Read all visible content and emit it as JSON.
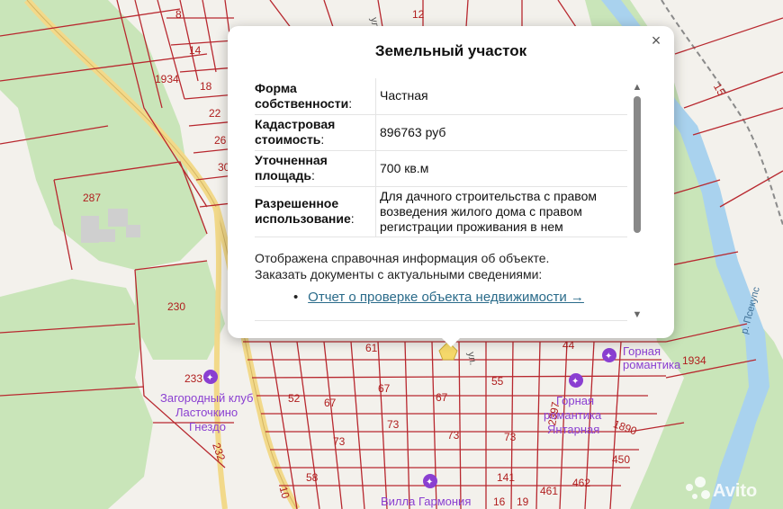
{
  "popup": {
    "title": "Земельный участок",
    "close_icon": "×",
    "rows": [
      {
        "label_line1": "Форма",
        "label_line2": "собственности",
        "value": "Частная"
      },
      {
        "label_line1": "Кадастровая",
        "label_line2": "стоимость",
        "value": "896763 руб"
      },
      {
        "label_line1": "Уточненная",
        "label_line2": "площадь",
        "value": "700 кв.м"
      },
      {
        "label_line1": "Разрешенное",
        "label_line2": "использование",
        "value": "Для дачного строительства с правом возведения жилого дома с правом регистрации проживания в нем"
      }
    ],
    "colon": ":",
    "note_line1": "Отображена справочная информация об объекте.",
    "note_line2": "Заказать документы с актуальными сведениями:",
    "report_bullet": "•",
    "report_link": "Отчет о проверке объекта недвижимости →",
    "scroll_up_icon": "▲",
    "scroll_down_icon": "▼"
  },
  "map": {
    "colors": {
      "background": "#f3f1ec",
      "forest": "#c9e5b9",
      "parcel_line": "#b8282f",
      "road": "#f2d98a",
      "river": "#a9d2ee",
      "poi": "#8a3fd1"
    },
    "parcel_labels": [
      "1934",
      "287",
      "230",
      "233",
      "232",
      "52",
      "67",
      "73",
      "58",
      "10",
      "14",
      "18",
      "22",
      "26",
      "30",
      "8",
      "12",
      "15",
      "61",
      "55",
      "67",
      "73",
      "73",
      "73",
      "67",
      "141",
      "461",
      "462",
      "450",
      "1890",
      "2397",
      "1934",
      "44",
      "16",
      "19"
    ],
    "poi_labels": [
      "Загородный клуб",
      "Ласточкино",
      "Гнездо",
      "Горная",
      "романтика",
      "Горная",
      "романтика",
      "Янтарная",
      "Вилла Гармония"
    ],
    "street_labels": [
      "ул.",
      "ул."
    ],
    "river_label": "р. Псекупс",
    "watermark": "Avito"
  }
}
